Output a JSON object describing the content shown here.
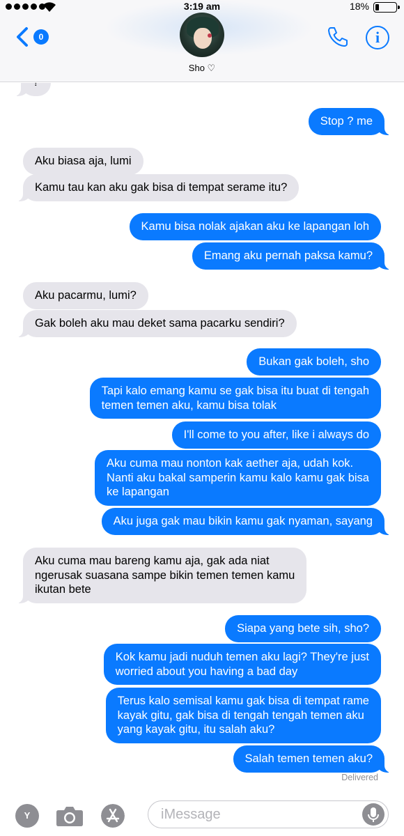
{
  "status_bar": {
    "time": "3:19 am",
    "battery_percent": "18%",
    "battery_level": 0.18
  },
  "header": {
    "back_badge": "0",
    "contact_name": "Sho ♡",
    "accent_color": "#0a7aff"
  },
  "messages": [
    {
      "side": "in",
      "text": "?"
    },
    {
      "side": "out",
      "text": "Stop ? me"
    },
    {
      "side": "in",
      "text": "Aku biasa aja, lumi"
    },
    {
      "side": "in",
      "text": "Kamu tau kan aku gak bisa di tempat serame itu?"
    },
    {
      "side": "out",
      "text": "Kamu bisa nolak ajakan aku ke lapangan loh"
    },
    {
      "side": "out",
      "text": "Emang aku pernah paksa kamu?"
    },
    {
      "side": "in",
      "text": "Aku pacarmu, lumi?"
    },
    {
      "side": "in",
      "text": "Gak boleh aku mau deket sama pacarku sendiri?"
    },
    {
      "side": "out",
      "text": "Bukan gak boleh, sho"
    },
    {
      "side": "out",
      "text": "Tapi kalo emang kamu se gak bisa itu buat di tengah\ntemen temen aku, kamu bisa tolak"
    },
    {
      "side": "out",
      "text": "I'll come to you after, like i always do"
    },
    {
      "side": "out",
      "text": "Aku cuma mau nonton kak aether aja, udah kok.\nNanti aku bakal samperin kamu kalo kamu gak bisa\nke lapangan"
    },
    {
      "side": "out",
      "text": "Aku juga gak mau bikin kamu gak nyaman, sayang"
    },
    {
      "side": "in",
      "text": "Aku cuma mau bareng kamu aja, gak ada niat\nngerusak suasana sampe bikin temen temen kamu\nikutan bete"
    },
    {
      "side": "out",
      "text": "Siapa yang bete sih, sho?"
    },
    {
      "side": "out",
      "text": "Kok kamu jadi nuduh temen aku lagi? They're just\nworried about you having a bad day"
    },
    {
      "side": "out",
      "text": "Terus kalo semisal kamu gak bisa di tempat rame\nkayak gitu, gak bisa di tengah tengah temen aku\nyang kayak gitu, itu salah aku?"
    },
    {
      "side": "out",
      "text": "Salah temen temen aku?"
    }
  ],
  "delivered_label": "Delivered",
  "input_bar": {
    "apps_label": "Y",
    "placeholder": "iMessage"
  }
}
